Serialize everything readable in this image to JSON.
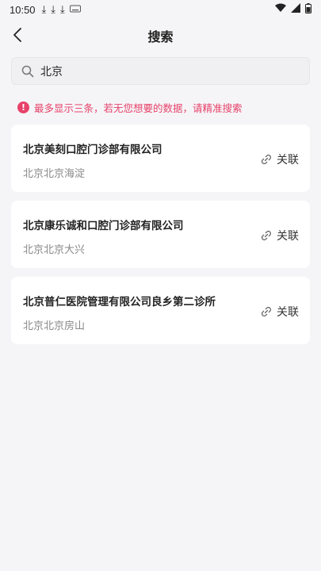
{
  "status_bar": {
    "time": "10:50",
    "icons": [
      "download-icon",
      "download-icon",
      "download-icon",
      "keyboard-icon",
      "wifi-icon",
      "signal-icon",
      "battery-icon"
    ]
  },
  "nav": {
    "title": "搜索"
  },
  "search": {
    "value": "北京",
    "placeholder": ""
  },
  "hint": {
    "text": "最多显示三条，若无您想要的数据，请精准搜索"
  },
  "results": [
    {
      "name": "北京美刻口腔门诊部有限公司",
      "region": "北京北京海淀",
      "action": "关联"
    },
    {
      "name": "北京康乐诚和口腔门诊部有限公司",
      "region": "北京北京大兴",
      "action": "关联"
    },
    {
      "name": "北京普仁医院管理有限公司良乡第二诊所",
      "region": "北京北京房山",
      "action": "关联"
    }
  ],
  "colors": {
    "accent": "#e8416a",
    "background": "#f5f5f7",
    "card": "#ffffff"
  }
}
